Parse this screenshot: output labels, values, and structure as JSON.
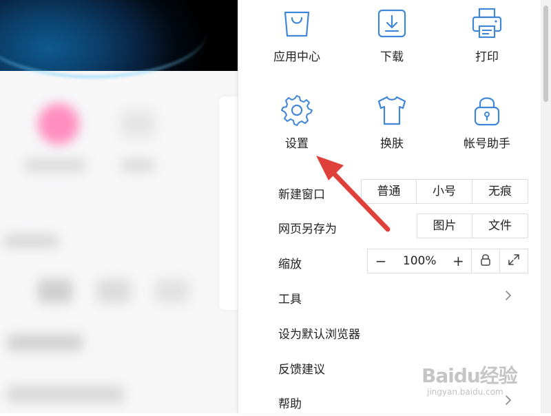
{
  "icon_grid": [
    {
      "label": "应用中心",
      "icon": "bag-icon"
    },
    {
      "label": "下载",
      "icon": "download-icon"
    },
    {
      "label": "打印",
      "icon": "printer-icon"
    },
    {
      "label": "设置",
      "icon": "gear-icon"
    },
    {
      "label": "换肤",
      "icon": "shirt-icon"
    },
    {
      "label": "帐号助手",
      "icon": "lock-icon"
    }
  ],
  "new_window": {
    "label": "新建窗口",
    "options": [
      "普通",
      "小号",
      "无痕"
    ]
  },
  "save_as": {
    "label": "网页另存为",
    "options": [
      "图片",
      "文件"
    ]
  },
  "zoom": {
    "label": "缩放",
    "minus": "−",
    "value": "100%",
    "plus": "+",
    "lock_icon": "lock-icon",
    "fullscreen_icon": "fullscreen-icon"
  },
  "menu_items": {
    "tools": "工具",
    "set_default": "设为默认浏览器",
    "feedback": "反馈建议",
    "help": "帮助"
  },
  "watermark": {
    "text": "Baidu经验",
    "sub": "jingyan.baidu.com"
  },
  "colors": {
    "icon_blue": "#3f86d6",
    "arrow_red": "#e0403a"
  }
}
